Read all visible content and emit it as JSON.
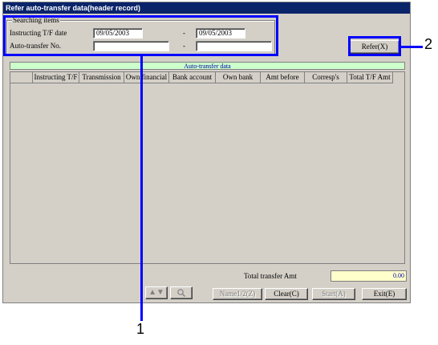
{
  "window": {
    "title": "Refer auto-transfer data(header record)"
  },
  "search": {
    "group_label": "Searching items",
    "date_label": "Instructing T/F date",
    "date_from": "09/05/2003",
    "date_sep": "-",
    "date_to": "09/05/2003",
    "autotransfer_label": "Auto-transfer No.",
    "autotransfer_from": "",
    "autotransfer_sep": "-",
    "autotransfer_to": ""
  },
  "refer_button": "Refer(X)",
  "table": {
    "title": "Auto-transfer data",
    "columns": [
      "",
      "Instructing T/F",
      "Transmission",
      "Own financial",
      "Bank account",
      "Own bank",
      "Amt before",
      "Corresp's",
      "Total T/F Amt"
    ]
  },
  "footer": {
    "total_label": "Total transfer Amt",
    "total_value": "0.00",
    "sort_icon": "up-down-arrows-icon",
    "search_icon": "magnifier-icon",
    "name_button": "Name1/2(Z)",
    "clear_button": "Clear(C)",
    "start_button": "Start(A)",
    "exit_button": "Exit(E)"
  },
  "callouts": {
    "one": "1",
    "two": "2"
  },
  "colors": {
    "titlebar": "#0a246a",
    "highlight": "#0000ff",
    "table_title_bg": "#ccffcc",
    "total_bg": "#ffffcc"
  }
}
